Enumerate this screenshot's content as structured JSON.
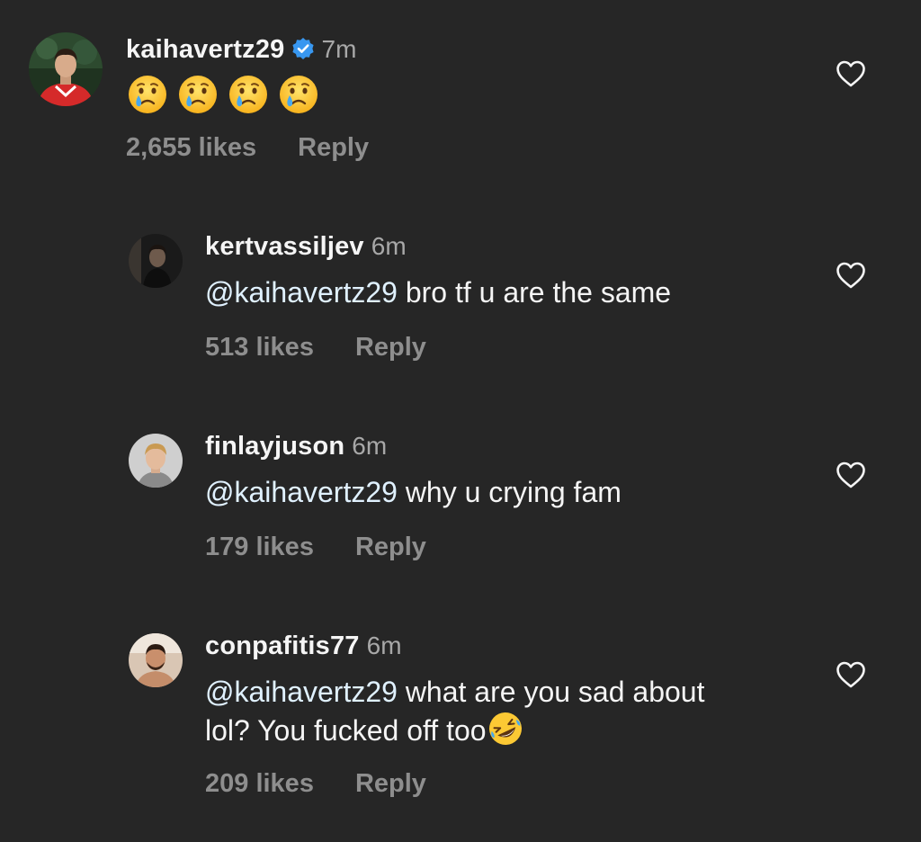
{
  "colors": {
    "background": "#262626",
    "primary_text": "#f5f5f5",
    "secondary_text": "#8e8e8e",
    "verified_blue": "#3897f0"
  },
  "comments": [
    {
      "username": "kaihavertz29",
      "verified": true,
      "time": "7m",
      "emoji": [
        "crying-face-icon",
        "crying-face-icon",
        "crying-face-icon",
        "crying-face-icon"
      ],
      "likes": "2,655 likes",
      "reply": "Reply"
    },
    {
      "username": "kertvassiljev",
      "time": "6m",
      "mention": "@kaihavertz29",
      "text": " bro tf u are the same",
      "likes": "513 likes",
      "reply": "Reply"
    },
    {
      "username": "finlayjuson",
      "time": "6m",
      "mention": "@kaihavertz29",
      "text": " why u crying fam",
      "likes": "179 likes",
      "reply": "Reply"
    },
    {
      "username": "conpafitis77",
      "time": "6m",
      "mention": "@kaihavertz29",
      "text": " what are you sad about lol? You fucked off too",
      "trailing_emoji": "rolling-on-floor-laughing-icon",
      "likes": "209 likes",
      "reply": "Reply"
    }
  ]
}
